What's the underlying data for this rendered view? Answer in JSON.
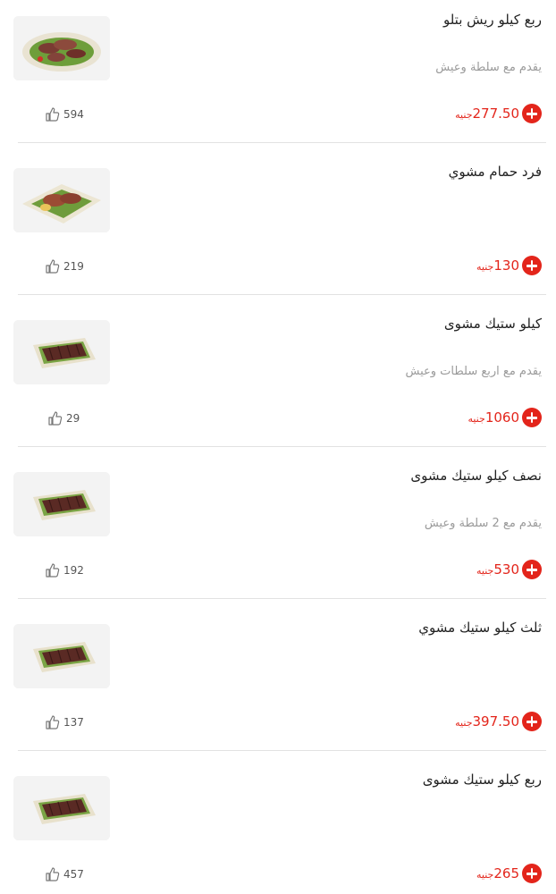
{
  "menu": {
    "items": [
      {
        "name": "ربع كيلو ريش بتلو",
        "description": "يقدم مع سلطة وعيش",
        "amount": "277.50",
        "currency": "جنيه",
        "likes": "594",
        "image": "veal-ribs"
      },
      {
        "name": "فرد حمام مشوي",
        "description": "",
        "amount": "130",
        "currency": "جنيه",
        "likes": "219",
        "image": "grilled-pigeon"
      },
      {
        "name": "كيلو ستيك مشوى",
        "description": "يقدم مع اربع سلطات وعيش",
        "amount": "1060",
        "currency": "جنيه",
        "likes": "29",
        "image": "steak-tray"
      },
      {
        "name": "نصف كيلو ستيك مشوى",
        "description": "يقدم مع 2 سلطة وعيش",
        "amount": "530",
        "currency": "جنيه",
        "likes": "192",
        "image": "steak-tray"
      },
      {
        "name": "ثلث كيلو ستيك مشوي",
        "description": "",
        "amount": "397.50",
        "currency": "جنيه",
        "likes": "137",
        "image": "steak-tray"
      },
      {
        "name": "ربع كيلو ستيك مشوى",
        "description": "",
        "amount": "265",
        "currency": "جنيه",
        "likes": "457",
        "image": "steak-tray"
      }
    ]
  },
  "icons": {
    "add": "plus-circle-icon",
    "like": "thumbs-up-icon"
  },
  "colors": {
    "accent": "#e3251b",
    "text": "#222222",
    "muted": "#9a9a9a",
    "divider": "#e2e2e2"
  }
}
